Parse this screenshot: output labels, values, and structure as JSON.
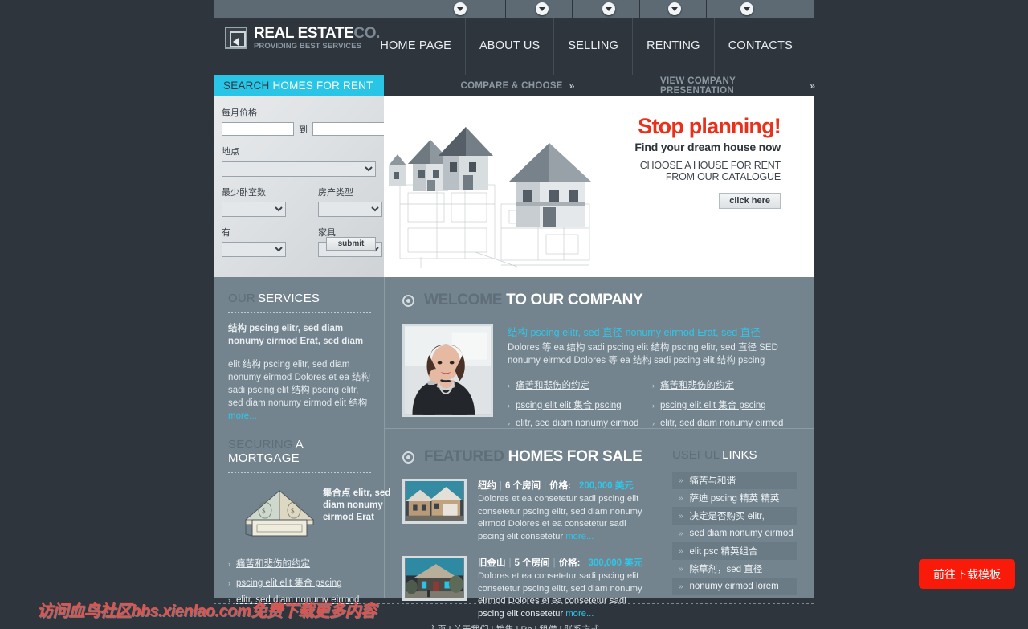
{
  "header": {
    "logo": {
      "line1_bold": "REAL ESTATE",
      "line1_light": "CO.",
      "line2": "PROVIDING BEST SERVICES"
    },
    "nav": [
      "HOME PAGE",
      "ABOUT US",
      "SELLING",
      "RENTING",
      "CONTACTS"
    ]
  },
  "search": {
    "title_a": "SEARCH",
    "title_b": "HOMES FOR RENT",
    "labels": {
      "price": "每月价格",
      "to": "到",
      "location": "地点",
      "bedrooms": "最少卧室数",
      "property_type": "房产类型",
      "has": "有",
      "furniture": "家具"
    },
    "price_min": "",
    "price_max": "",
    "location_value": "",
    "bedrooms_value": "",
    "property_type_value": "",
    "has_value": "",
    "furniture_value": "",
    "submit": "submit"
  },
  "cta": {
    "compare": "COMPARE & CHOOSE",
    "presentation": "VIEW COMPANY PRESENTATION",
    "chevron": "»"
  },
  "hero": {
    "headline": "Stop planning!",
    "subhead": "Find your dream house now",
    "line3": "CHOOSE A HOUSE FOR RENT",
    "line4": "FROM OUR CATALOGUE",
    "button": "click here"
  },
  "services": {
    "title_a": "OUR",
    "title_b": "SERVICES",
    "lead": "结构 pscing elitr,  sed diam nonumy eirmod Erat,  sed diam",
    "para": "elit 结构 pscing elitr,  sed diam nonumy eirmod Dolores et ea 结构 sadi pscing elit 结构 pscing elitr,  sed diam nonumy eirmod elit 结构",
    "more": "more..."
  },
  "mortgage": {
    "title_a": "SECURING",
    "title_b": "A MORTGAGE",
    "lead": "集合点 elitr, sed diam nonumy eirmod Erat",
    "links": [
      "痛苦和悲伤的约定",
      "pscing elit elit 集合 pscing",
      "elitr, sed diam nonumy eirmod"
    ]
  },
  "welcome": {
    "title_a": "WELCOME",
    "title_b": "TO OUR COMPANY",
    "highlight": "结构 pscing elitr,  sed 直径 nonumy eirmod Erat,  sed 直径",
    "para": "Dolores 等 ea 结构 sadi pscing elit 结构 pscing elitr,  sed 直径 SED nonumy eirmod Dolores 等 ea 结构 sadi pscing elit 结构 pscing",
    "links_left": [
      "痛苦和悲伤的约定",
      "pscing elit elit 集合 pscing",
      "elitr, sed diam nonumy eirmod"
    ],
    "links_right": [
      "痛苦和悲伤的约定",
      "pscing elit elit 集合 pscing",
      "elitr, sed diam nonumy eirmod"
    ]
  },
  "featured": {
    "title_a": "FEATURED",
    "title_b": "HOMES FOR SALE",
    "listings": [
      {
        "city": "纽约",
        "rooms": "6 个房间",
        "price_label": "价格:",
        "price": "200,000 美元",
        "body": "Dolores et ea consetetur sadi pscing elit consetetur pscing elitr, sed diam nonumy eirmod Dolores et ea consetetur sadi pscing elit consetetur",
        "more": "more..."
      },
      {
        "city": "旧金山",
        "rooms": "5 个房间",
        "price_label": "价格:",
        "price": "300,000 美元",
        "body": "Dolores et ea consetetur sadi pscing elit consetetur pscing elitr, sed diam nonumy eirmod Dolores et ea consetetur sadi pscing elit consetetur",
        "more": "more..."
      }
    ]
  },
  "useful_links": {
    "title_a": "USEFUL",
    "title_b": "LINKS",
    "items": [
      "痛苦与和谐",
      "萨迪 pscing 精英 精英",
      "决定是否购买 elitr,",
      "sed diam nonumy eirmod",
      "elit psc 精英组合",
      "除草剂，sed 直径",
      "nonumy eirmod lorem"
    ]
  },
  "footer": {
    "nav": "主页 | 关于我们 | 销售 | Rb | 租借 | 联系方式"
  },
  "overlay": {
    "watermark": "访问血鸟社区bbs.xienlao.com免费下载更多内容",
    "download_button": "前往下载模板"
  },
  "colors": {
    "accent_cyan": "#29c5e6",
    "dark": "#2f353d",
    "panel": "#73848f",
    "red": "#e8301b",
    "download_red": "#fa1a0a"
  }
}
